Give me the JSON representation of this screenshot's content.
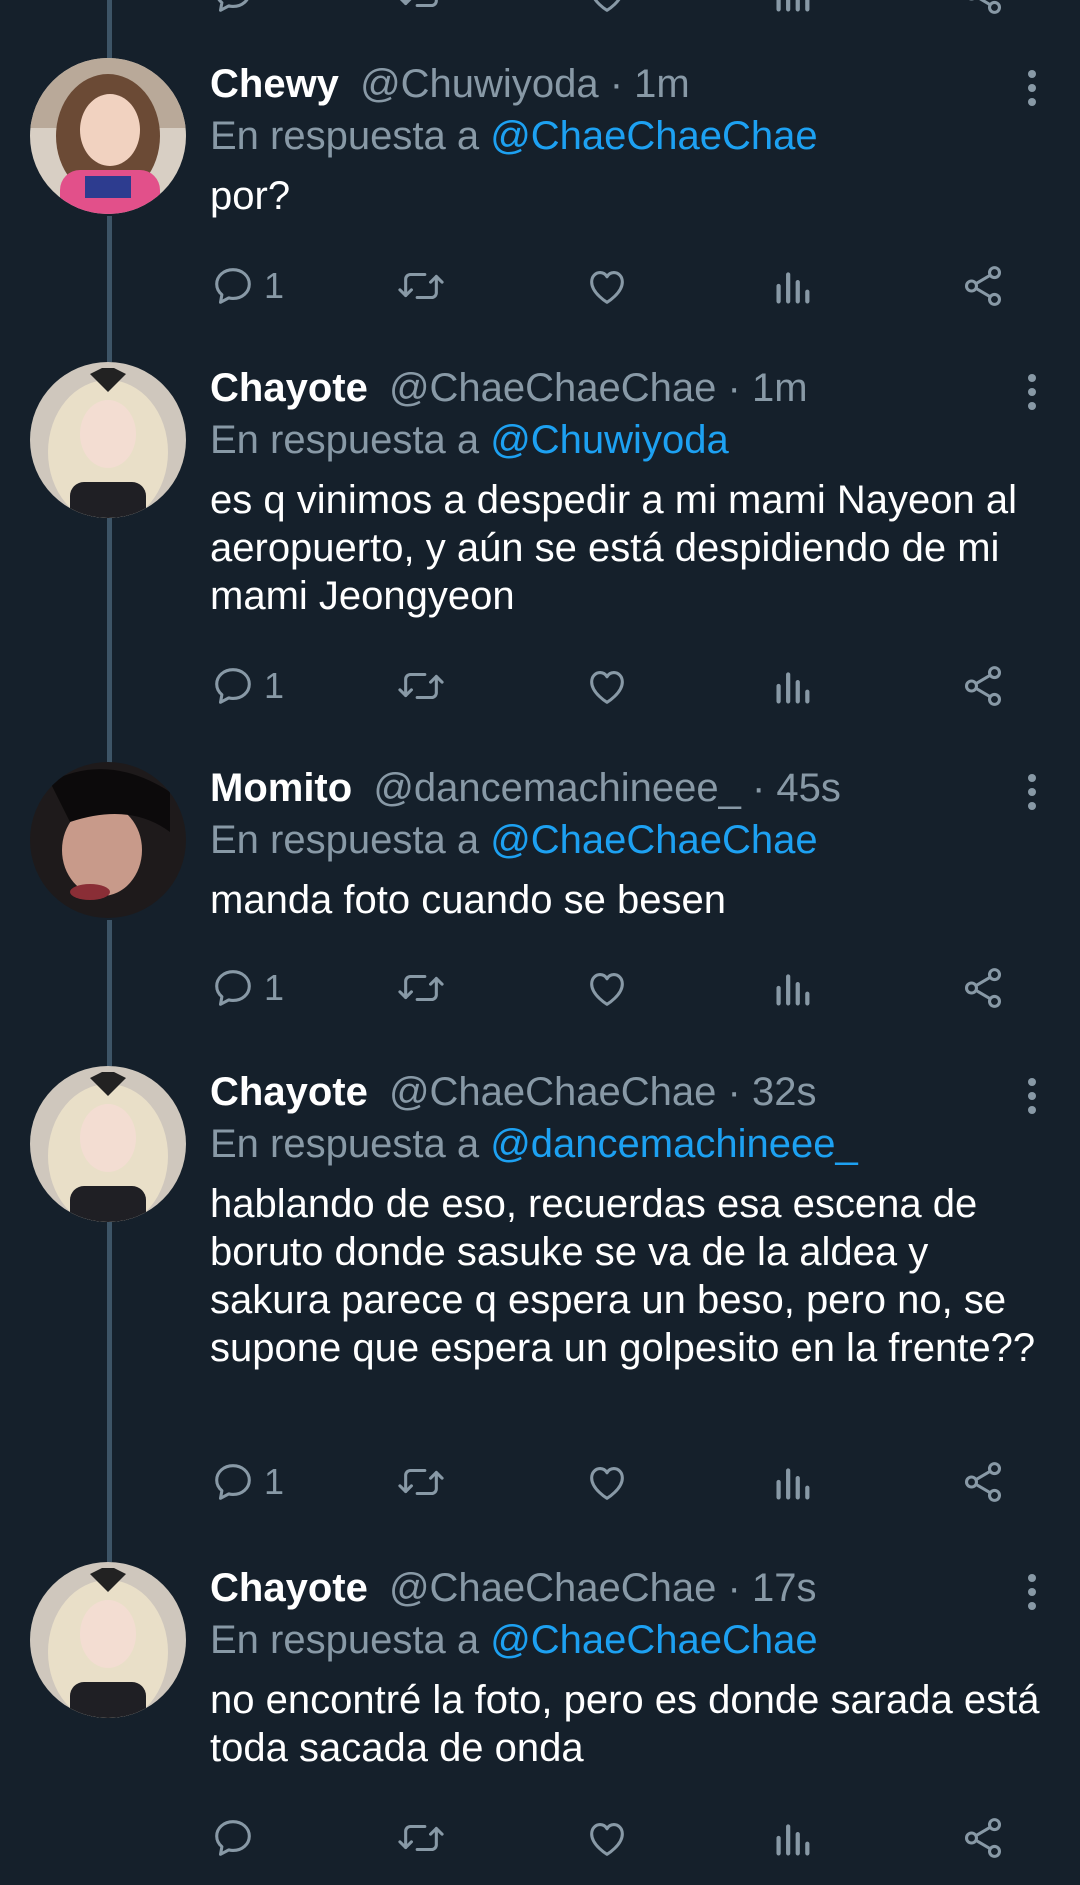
{
  "tweets": [
    {
      "name": "Chewy",
      "handle": "@Chuwiyoda",
      "time": "· 1m",
      "reply_prefix": "En respuesta a",
      "reply_to": "@ChaeChaeChae",
      "text": "por?",
      "reply_count": "1",
      "avatar": "avatar-photo"
    },
    {
      "name": "Chayote",
      "handle": "@ChaeChaeChae",
      "time": "· 1m",
      "reply_prefix": "En respuesta a",
      "reply_to": "@Chuwiyoda",
      "text": "es q vinimos a despedir a mi mami Nayeon al aeropuerto, y aún se está despidiendo de mi mami Jeongyeon",
      "reply_count": "1",
      "avatar": "avatar-photo"
    },
    {
      "name": "Momito",
      "handle": "@dancemachineee_",
      "time": "· 45s",
      "reply_prefix": "En respuesta a",
      "reply_to": "@ChaeChaeChae",
      "text": "manda foto cuando se besen",
      "reply_count": "1",
      "avatar": "avatar-photo"
    },
    {
      "name": "Chayote",
      "handle": "@ChaeChaeChae",
      "time": "· 32s",
      "reply_prefix": "En respuesta a",
      "reply_to": "@dancemachineee_",
      "text": "hablando de eso, recuerdas esa escena de boruto donde sasuke se va de la aldea y sakura parece q espera un beso, pero no, se supone que espera un golpesito en la frente??",
      "reply_count": "1",
      "avatar": "avatar-photo"
    },
    {
      "name": "Chayote",
      "handle": "@ChaeChaeChae",
      "time": "· 17s",
      "reply_prefix": "En respuesta a",
      "reply_to": "@ChaeChaeChae",
      "text": "no encontré la foto, pero es donde sarada está toda sacada de onda",
      "reply_count": "",
      "avatar": "avatar-photo"
    }
  ],
  "icons": {
    "reply": "speech-bubble-icon",
    "retweet": "retweet-arrows-icon",
    "like": "heart-icon",
    "views": "bar-chart-icon",
    "share": "share-nodes-icon",
    "more": "vertical-dots-icon"
  },
  "colors": {
    "background": "#15202b",
    "text": "#ffffff",
    "secondary": "#8899a6",
    "link": "#1da1f2",
    "thread_line": "#3d5466"
  }
}
